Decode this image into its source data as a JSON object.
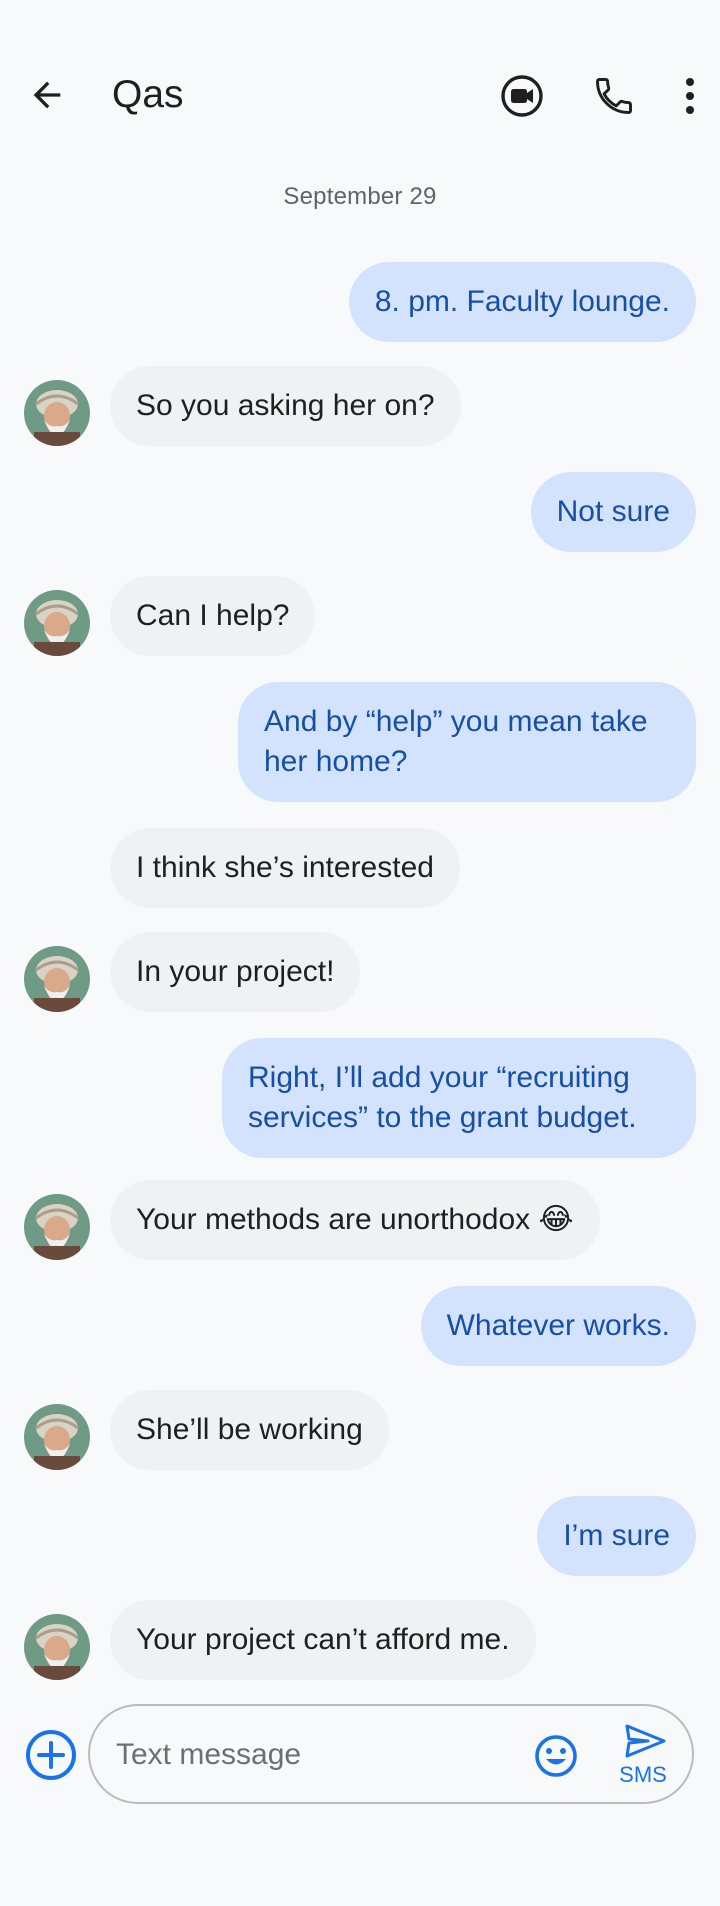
{
  "header": {
    "contact_name": "Qas",
    "icons": [
      "arrow-back-icon",
      "video-call-icon",
      "phone-icon",
      "more-vert-icon"
    ]
  },
  "conversation": {
    "date_divider": "September 29",
    "messages": [
      {
        "direction": "outgoing",
        "text": "8. pm. Faculty lounge."
      },
      {
        "direction": "incoming",
        "text": "So you asking her on?"
      },
      {
        "direction": "outgoing",
        "text": "Not sure"
      },
      {
        "direction": "incoming",
        "text": "Can I help?"
      },
      {
        "direction": "outgoing",
        "text": "And by “help” you mean take her home?"
      },
      {
        "direction": "incoming",
        "text": "I think she’s interested"
      },
      {
        "direction": "incoming",
        "text": "In your project!"
      },
      {
        "direction": "outgoing",
        "text": "Right, I’ll add your “recruiting services” to the grant budget."
      },
      {
        "direction": "incoming",
        "text": "Your methods are unorthodox 😂"
      },
      {
        "direction": "outgoing",
        "text": "Whatever works."
      },
      {
        "direction": "incoming",
        "text": "She’ll be working"
      },
      {
        "direction": "outgoing",
        "text": "I’m sure"
      },
      {
        "direction": "incoming",
        "text": "Your project can’t afford me."
      }
    ]
  },
  "composer": {
    "placeholder": "Text message",
    "send_label": "SMS",
    "icons": [
      "add-circle-icon",
      "emoji-icon",
      "send-icon"
    ]
  },
  "colors": {
    "outgoing_bubble": "#d3e3fd",
    "outgoing_text": "#174ea6",
    "incoming_bubble": "#eff1f3",
    "accent": "#1a73e8"
  }
}
